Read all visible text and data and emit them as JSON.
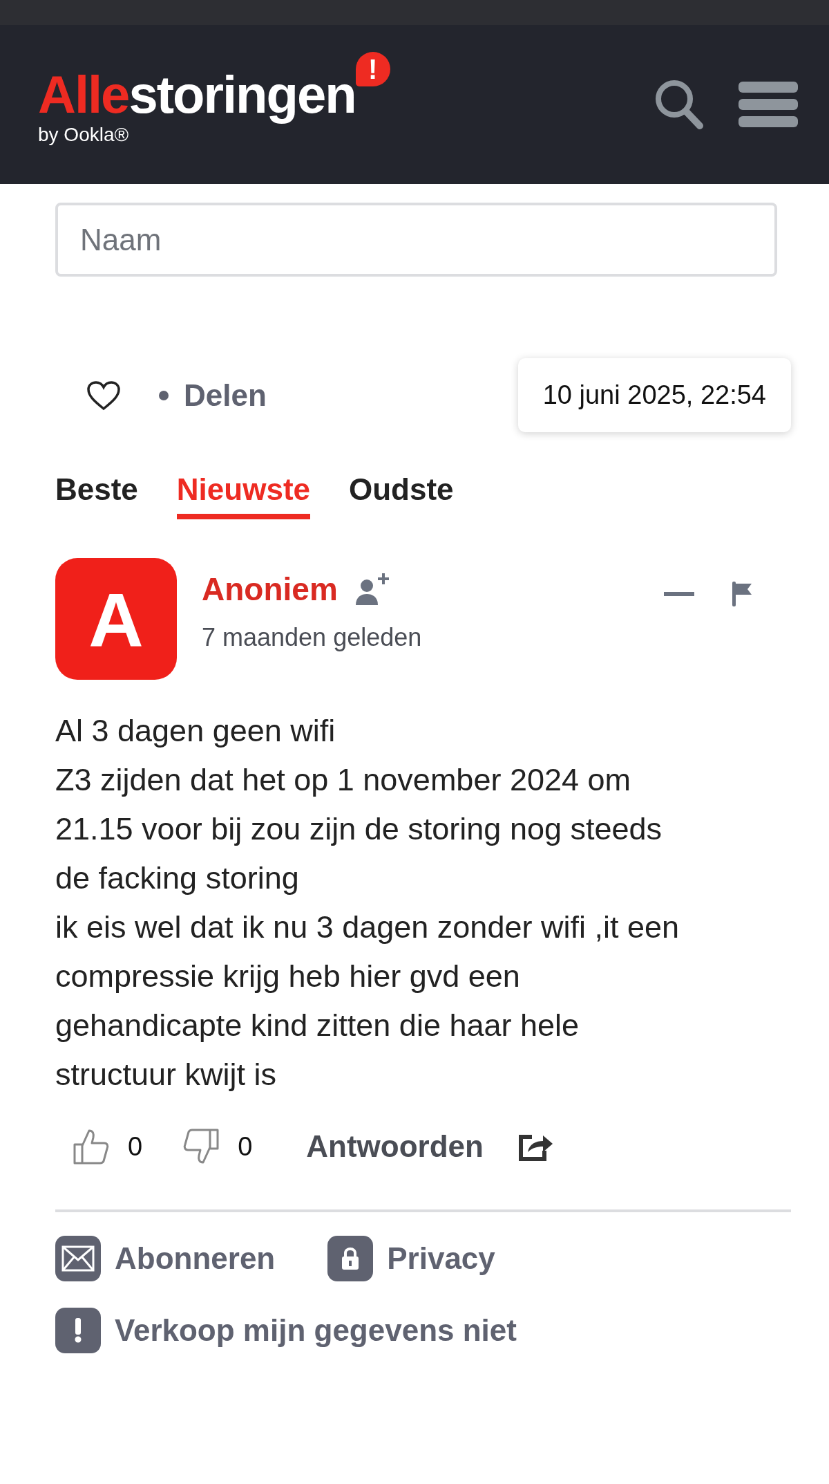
{
  "header": {
    "logo_accent": "Alle",
    "logo_rest": "storingen",
    "logo_badge": "!",
    "byline": "by Ookla®"
  },
  "name_field": {
    "placeholder": "Naam"
  },
  "share_bar": {
    "liked": false,
    "share_label": "Delen",
    "tooltip": "10 juni 2025, 22:54"
  },
  "sort_tabs": [
    {
      "label": "Beste",
      "selected": false
    },
    {
      "label": "Nieuwste",
      "selected": true
    },
    {
      "label": "Oudste",
      "selected": false
    }
  ],
  "comment": {
    "avatar_letter": "A",
    "author": "Anoniem",
    "time": "7 maanden geleden",
    "text": "Al 3 dagen geen wifi\nZ3 zijden dat het op 1 november 2024 om\n21.15 voor bij zou zijn de storing nog steeds\nde facking storing\nik eis wel dat ik nu 3 dagen zonder wifi ,it een\ncompressie krijg heb hier gvd een\ngehandicapte kind zitten die haar hele\nstructuur kwijt is",
    "likes": "0",
    "dislikes": "0",
    "reply_label": "Antwoorden"
  },
  "footer_links": [
    {
      "kind": "mail",
      "label": "Abonneren"
    },
    {
      "kind": "lock",
      "label": "Privacy"
    },
    {
      "kind": "alert",
      "label": "Verkoop mijn gegevens niet"
    }
  ]
}
